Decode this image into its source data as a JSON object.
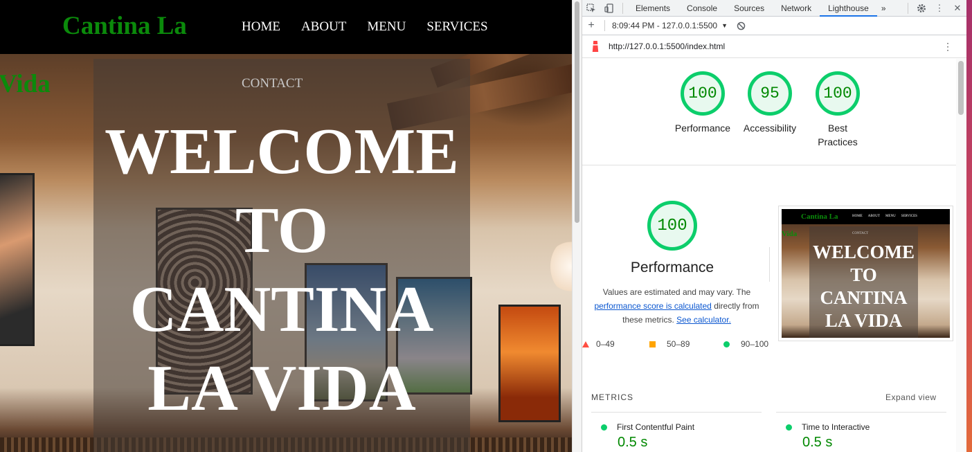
{
  "site": {
    "logo": "Cantina La",
    "logo_overflow": "Vida",
    "nav": [
      "HOME",
      "ABOUT",
      "MENU",
      "SERVICES"
    ],
    "contact": "CONTACT",
    "hero_lines": [
      "WELCOME",
      "TO",
      "CANTINA",
      "LA VIDA"
    ]
  },
  "devtools": {
    "tabs": [
      "Elements",
      "Console",
      "Sources",
      "Network",
      "Lighthouse"
    ],
    "active_tab": "Lighthouse",
    "more_tabs": "»",
    "report_time": "8:09:44 PM - 127.0.0.1:5500",
    "url": "http://127.0.0.1:5500/index.html",
    "scores": [
      {
        "value": "100",
        "label": "Performance"
      },
      {
        "value": "95",
        "label": "Accessibility"
      },
      {
        "value": "100",
        "label": "Best Practices"
      }
    ],
    "performance": {
      "score": "100",
      "title": "Performance",
      "desc_before": "Values are estimated and may vary. The",
      "desc_link1": "performance score is calculated",
      "desc_middle": "directly from these metrics.",
      "desc_link2": "See calculator.",
      "legend": [
        "0–49",
        "50–89",
        "90–100"
      ]
    },
    "thumbnail": {
      "logo": "Cantina La",
      "nav": [
        "HOME",
        "ABOUT",
        "MENU",
        "SERVICES"
      ],
      "vida": "Vida",
      "contact": "CONTACT",
      "title_lines": [
        "WELCOME",
        "TO",
        "CANTINA",
        "LA VIDA"
      ]
    },
    "metrics_heading": "METRICS",
    "expand_view": "Expand view",
    "metrics": [
      {
        "name": "First Contentful Paint",
        "value": "0.5 s"
      },
      {
        "name": "Time to Interactive",
        "value": "0.5 s"
      }
    ],
    "colors": {
      "pass": "#0cce6b",
      "average": "#ffa400",
      "fail": "#ff4e42",
      "link": "#0b57d0",
      "brand_green": "#0b8a0b"
    }
  }
}
